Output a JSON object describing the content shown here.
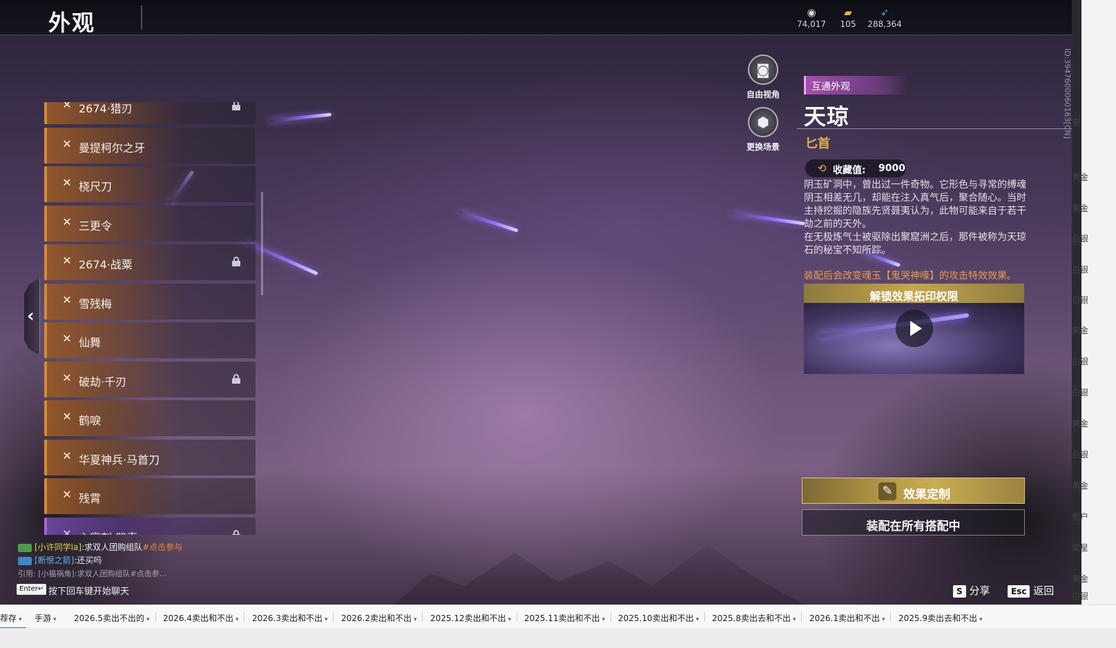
{
  "header": {
    "title": "外观"
  },
  "currencies": [
    {
      "icon": "swirl-currency-icon",
      "value": "74,017"
    },
    {
      "icon": "gold-ticket-icon",
      "value": "105"
    },
    {
      "icon": "feather-currency-icon",
      "value": "288,364"
    }
  ],
  "list": {
    "items": [
      {
        "label": "2674·猎刃",
        "locked": true,
        "rarity": "orange"
      },
      {
        "label": "曼提柯尔之牙",
        "locked": false,
        "rarity": "orange"
      },
      {
        "label": "桡尺刀",
        "locked": false,
        "rarity": "orange"
      },
      {
        "label": "三更令",
        "locked": false,
        "rarity": "orange"
      },
      {
        "label": "2674·战粟",
        "locked": true,
        "rarity": "orange"
      },
      {
        "label": "雪残梅",
        "locked": false,
        "rarity": "orange"
      },
      {
        "label": "仙舞",
        "locked": false,
        "rarity": "orange"
      },
      {
        "label": "破劫·千刃",
        "locked": true,
        "rarity": "orange"
      },
      {
        "label": "鹤唳",
        "locked": false,
        "rarity": "orange"
      },
      {
        "label": "华夏神兵·马首刀",
        "locked": false,
        "rarity": "orange"
      },
      {
        "label": "残霄",
        "locked": false,
        "rarity": "orange"
      },
      {
        "label": "心魔刺·咒毒",
        "locked": true,
        "rarity": "purple"
      }
    ]
  },
  "camera": {
    "free_view_label": "自由视角",
    "change_scene_label": "更换场景"
  },
  "detail": {
    "tag": "互通外观",
    "name": "天琼",
    "type": "匕首",
    "collection_label": "收藏值:",
    "collection_value": "9000",
    "description": [
      "阴玉矿洞中，曾出过一件奇物。它形色与寻常的缚魂阴玉相差无几，却能在注入真气后，聚合随心。当时主持挖掘的隐族先贤聂夷认为，此物可能来自于若干劫之前的天外。",
      "在无极炼气士被驱除出聚窟洲之后，那件被称为天琼石的秘宝不知所踪。"
    ],
    "effect_note": "装配后会改变魂玉【鬼哭神嚎】的攻击特效效果。",
    "unlock_banner": "解锁效果拓印权限",
    "customize_button": "效果定制",
    "equip_all_button": "装配在所有搭配中",
    "side_id": "ID:3947600060163[CN]"
  },
  "chat": {
    "lines": [
      {
        "name": "[小许同学la]",
        "message": ":求双人团购组队",
        "link": "#点击参与"
      },
      {
        "name": "[断恨之箭]",
        "message": ":还买吗",
        "link": ""
      }
    ],
    "quote": "引用: [小猫祸角]:求双人团购组队#点击参…",
    "enter_key": "Enter↵",
    "hint": "按下回车键开始聊天"
  },
  "footer": {
    "share_key": "S",
    "share_label": "分享",
    "back_key": "Esc",
    "back_label": "返回"
  },
  "edge_words": [
    "查",
    "黄金",
    "黄金",
    "白银",
    "白银",
    "白银",
    "黄金",
    "白银",
    "白银",
    "黄金",
    "白银",
    "黄金",
    "他户",
    "奖星",
    "黄金",
    "白银"
  ],
  "bookmarks": [
    "荐存",
    "手游",
    "2026.5卖出不出的",
    "2026.4卖出和不出",
    "2026.3卖出和不出",
    "2026.2卖出和不出",
    "2025.12卖出和不出",
    "2025.11卖出和不出",
    "2025.10卖出和不出",
    "2025.8卖出去和不出",
    "2026.1卖出和不出",
    "2025.9卖出去和不出"
  ],
  "colors": {
    "accent_orange": "#d48a38",
    "accent_gold": "#e3b04a",
    "tag_purple": "#aa50b4",
    "effect_note": "#e99a4e",
    "chat_name_yellow": "#e6d34a",
    "chat_name_blue": "#5fb8f0"
  }
}
